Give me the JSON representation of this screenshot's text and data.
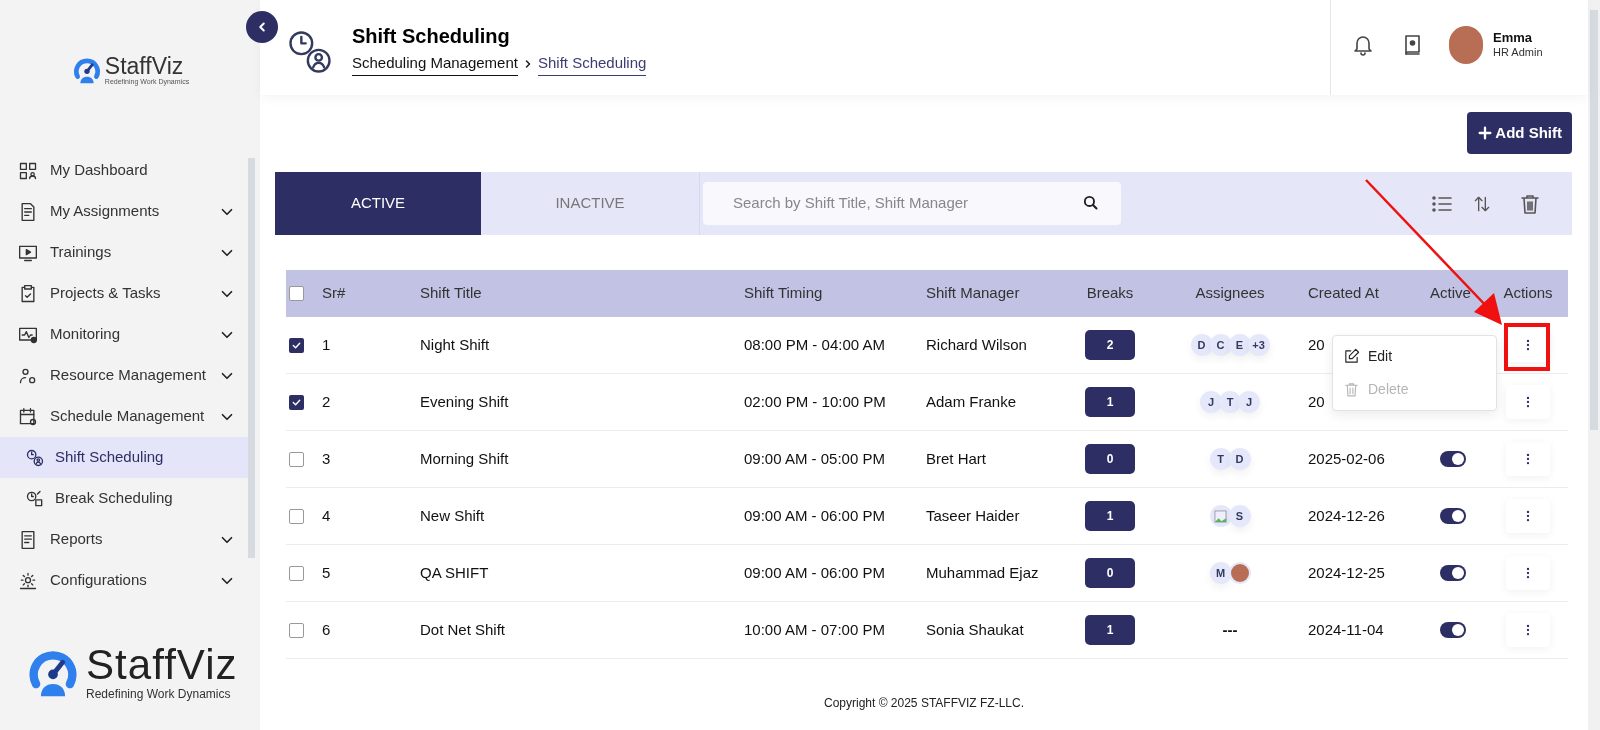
{
  "sidebar": {
    "logo": {
      "name": "StaffViz",
      "tagline": "Redefining Work Dynamics"
    },
    "items": [
      {
        "label": "My Dashboard",
        "has_submenu": false,
        "selected": false
      },
      {
        "label": "My Assignments",
        "has_submenu": true,
        "selected": false
      },
      {
        "label": "Trainings",
        "has_submenu": true,
        "selected": false
      },
      {
        "label": "Projects & Tasks",
        "has_submenu": true,
        "selected": false
      },
      {
        "label": "Monitoring",
        "has_submenu": true,
        "selected": false
      },
      {
        "label": "Resource Management",
        "has_submenu": true,
        "selected": false
      },
      {
        "label": "Schedule Management",
        "has_submenu": true,
        "selected": false,
        "children": [
          {
            "label": "Shift Scheduling",
            "selected": true
          },
          {
            "label": "Break Scheduling",
            "selected": false
          }
        ]
      },
      {
        "label": "Reports",
        "has_submenu": true,
        "selected": false
      },
      {
        "label": "Configurations",
        "has_submenu": true,
        "selected": false
      }
    ],
    "footer_logo": {
      "name": "StaffViz",
      "tagline": "Redefining Work Dynamics"
    }
  },
  "header": {
    "title": "Shift Scheduling",
    "breadcrumb": [
      "Scheduling Management",
      "Shift Scheduling"
    ],
    "user": {
      "name": "Emma",
      "role": "HR Admin"
    }
  },
  "add_button": "Add Shift",
  "tabs": [
    {
      "label": "ACTIVE",
      "selected": true
    },
    {
      "label": "INACTIVE",
      "selected": false
    }
  ],
  "search": {
    "placeholder": "Search by Shift Title, Shift Manager"
  },
  "table": {
    "select_all": false,
    "columns": [
      "Sr#",
      "Shift Title",
      "Shift Timing",
      "Shift Manager",
      "Breaks",
      "Assignees",
      "Created At",
      "Active",
      "Actions"
    ],
    "rows": [
      {
        "checked": true,
        "sr": "1",
        "title": "Night Shift",
        "timing": "08:00 PM - 04:00 AM",
        "manager": "Richard Wilson",
        "breaks": "2",
        "assignees": [
          {
            "kind": "initial",
            "text": "D"
          },
          {
            "kind": "initial",
            "text": "C"
          },
          {
            "kind": "initial",
            "text": "E"
          },
          {
            "kind": "initial",
            "text": "+3"
          }
        ],
        "created": "20"
      },
      {
        "checked": true,
        "sr": "2",
        "title": "Evening Shift",
        "timing": "02:00 PM - 10:00 PM",
        "manager": "Adam Franke",
        "breaks": "1",
        "assignees": [
          {
            "kind": "initial",
            "text": "J"
          },
          {
            "kind": "initial",
            "text": "T"
          },
          {
            "kind": "initial",
            "text": "J"
          }
        ],
        "created": "20"
      },
      {
        "checked": false,
        "sr": "3",
        "title": "Morning Shift",
        "timing": "09:00 AM - 05:00 PM",
        "manager": "Bret Hart",
        "breaks": "0",
        "assignees": [
          {
            "kind": "initial",
            "text": "T"
          },
          {
            "kind": "initial",
            "text": "D"
          }
        ],
        "created": "2025-02-06",
        "active": true
      },
      {
        "checked": false,
        "sr": "4",
        "title": "New Shift",
        "timing": "09:00 AM - 06:00 PM",
        "manager": "Taseer Haider",
        "breaks": "1",
        "assignees": [
          {
            "kind": "image"
          },
          {
            "kind": "initial",
            "text": "S"
          }
        ],
        "created": "2024-12-26",
        "active": true
      },
      {
        "checked": false,
        "sr": "5",
        "title": "QA SHIFT",
        "timing": "09:00 AM - 06:00 PM",
        "manager": "Muhammad Ejaz",
        "breaks": "0",
        "assignees": [
          {
            "kind": "initial",
            "text": "M"
          },
          {
            "kind": "photo"
          }
        ],
        "created": "2024-12-25",
        "active": true
      },
      {
        "checked": false,
        "sr": "6",
        "title": "Dot Net Shift",
        "timing": "10:00 AM - 07:00 PM",
        "manager": "Sonia Shaukat",
        "breaks": "1",
        "assignees_text": "---",
        "created": "2024-11-04",
        "active": true
      }
    ]
  },
  "menu": [
    {
      "label": "Edit",
      "kind": "edit",
      "disabled": false
    },
    {
      "label": "Delete",
      "kind": "delete",
      "disabled": true
    }
  ],
  "footer": "Copyright © 2025 STAFFVIZ FZ-LLC."
}
